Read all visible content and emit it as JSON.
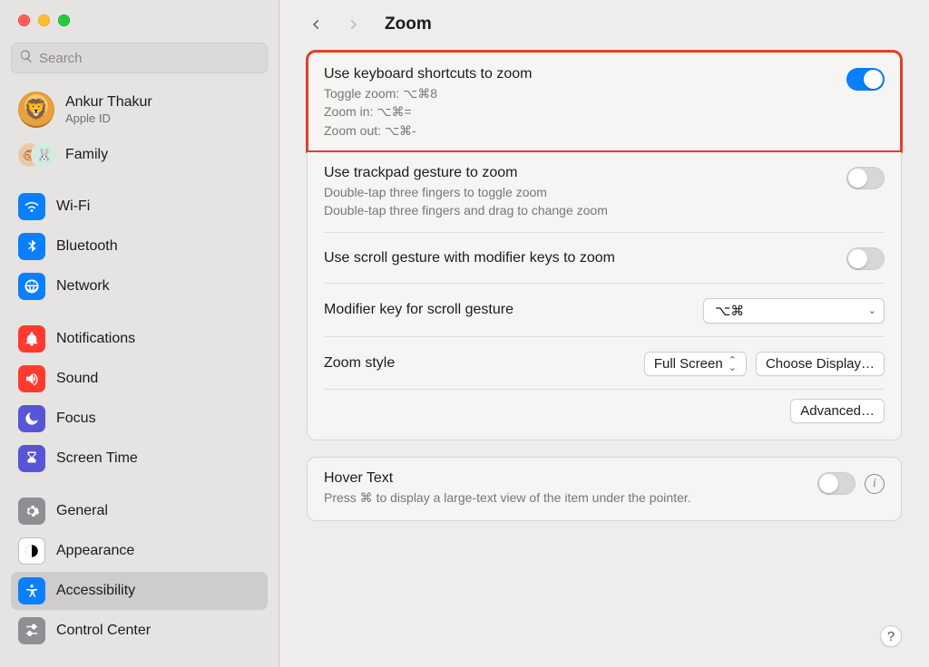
{
  "window": {
    "title": "Zoom"
  },
  "search": {
    "placeholder": "Search"
  },
  "account": {
    "name": "Ankur Thakur",
    "sub": "Apple ID"
  },
  "family": {
    "label": "Family"
  },
  "sidebar": {
    "g1": [
      {
        "label": "Wi-Fi",
        "color": "#0a7fff",
        "icon": "wifi"
      },
      {
        "label": "Bluetooth",
        "color": "#0a7fff",
        "icon": "bluetooth"
      },
      {
        "label": "Network",
        "color": "#0a7fff",
        "icon": "globe"
      }
    ],
    "g2": [
      {
        "label": "Notifications",
        "color": "#ff3b30",
        "icon": "bell"
      },
      {
        "label": "Sound",
        "color": "#ff3b30",
        "icon": "speaker"
      },
      {
        "label": "Focus",
        "color": "#5856d6",
        "icon": "moon"
      },
      {
        "label": "Screen Time",
        "color": "#5856d6",
        "icon": "hourglass"
      }
    ],
    "g3": [
      {
        "label": "General",
        "style": "grey",
        "icon": "gear"
      },
      {
        "label": "Appearance",
        "style": "outline",
        "icon": "appearance"
      },
      {
        "label": "Accessibility",
        "color": "#0a7fff",
        "icon": "accessibility",
        "selected": true
      },
      {
        "label": "Control Center",
        "style": "grey",
        "icon": "sliders"
      }
    ]
  },
  "settings": {
    "keyboard_shortcuts": {
      "title": "Use keyboard shortcuts to zoom",
      "desc": "Toggle zoom: ⌥⌘8\nZoom in: ⌥⌘=\nZoom out: ⌥⌘-",
      "on": true
    },
    "trackpad_gesture": {
      "title": "Use trackpad gesture to zoom",
      "desc": "Double-tap three fingers to toggle zoom\nDouble-tap three fingers and drag to change zoom",
      "on": false
    },
    "scroll_gesture": {
      "title": "Use scroll gesture with modifier keys to zoom",
      "on": false
    },
    "modifier_key": {
      "title": "Modifier key for scroll gesture",
      "value": "⌥⌘"
    },
    "zoom_style": {
      "title": "Zoom style",
      "value": "Full Screen",
      "choose_display": "Choose Display…"
    },
    "advanced": "Advanced…",
    "hover_text": {
      "title": "Hover Text",
      "desc": "Press ⌘ to display a large-text view of the item under the pointer.",
      "on": false
    }
  },
  "help_label": "?"
}
